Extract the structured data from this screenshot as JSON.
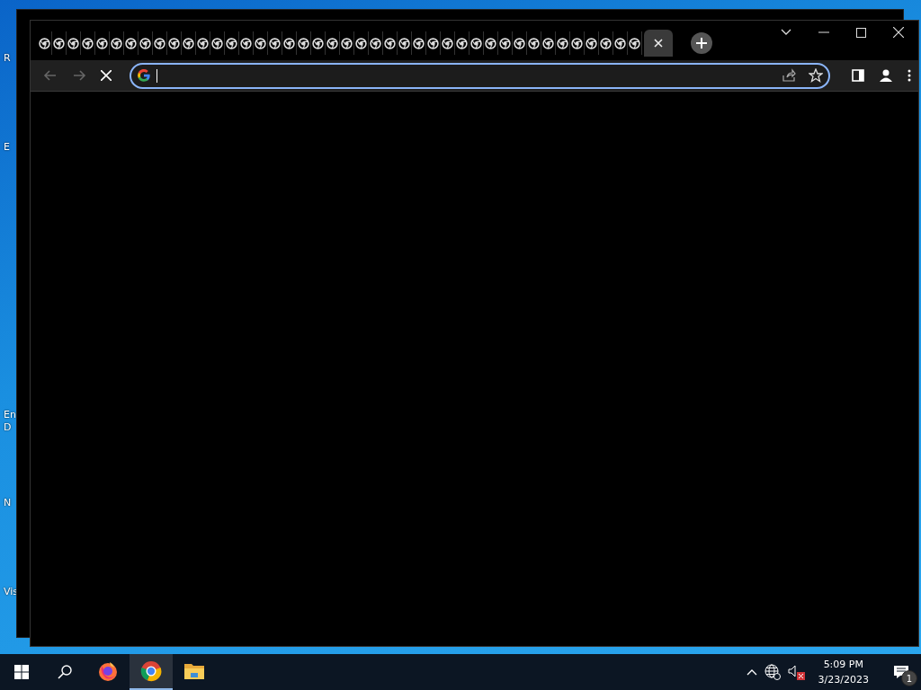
{
  "desktop": {
    "icon_labels": [
      "R",
      "E",
      "En",
      "D",
      "N",
      "Vis"
    ]
  },
  "browser": {
    "tabs": [
      {
        "selected": false
      },
      {
        "selected": false
      },
      {
        "selected": false
      },
      {
        "selected": false
      },
      {
        "selected": false
      },
      {
        "selected": false
      },
      {
        "selected": false
      },
      {
        "selected": false
      },
      {
        "selected": false
      },
      {
        "selected": false
      },
      {
        "selected": false
      },
      {
        "selected": false
      },
      {
        "selected": false
      },
      {
        "selected": false
      },
      {
        "selected": false
      },
      {
        "selected": false
      },
      {
        "selected": false
      },
      {
        "selected": false
      },
      {
        "selected": false
      },
      {
        "selected": false
      },
      {
        "selected": false
      },
      {
        "selected": false
      },
      {
        "selected": false
      },
      {
        "selected": false
      },
      {
        "selected": false
      },
      {
        "selected": false
      },
      {
        "selected": false
      },
      {
        "selected": false
      },
      {
        "selected": false
      },
      {
        "selected": false
      },
      {
        "selected": false
      },
      {
        "selected": false
      },
      {
        "selected": false
      },
      {
        "selected": false
      },
      {
        "selected": false
      },
      {
        "selected": false
      },
      {
        "selected": false
      },
      {
        "selected": false
      },
      {
        "selected": false
      },
      {
        "selected": false
      },
      {
        "selected": false
      },
      {
        "selected": false
      },
      {
        "selected": true
      }
    ],
    "toolbar": {
      "back_disabled": true,
      "forward_disabled": true,
      "loading": true
    },
    "omnibox": {
      "focused": true
    }
  },
  "taskbar": {
    "apps": [
      {
        "kind": "firefox",
        "selected": false
      },
      {
        "kind": "chrome",
        "selected": true
      },
      {
        "kind": "explorer",
        "selected": false
      }
    ],
    "volume_muted": true,
    "time": "5:09 PM",
    "date": "3/23/2023",
    "notification_count": "1"
  }
}
